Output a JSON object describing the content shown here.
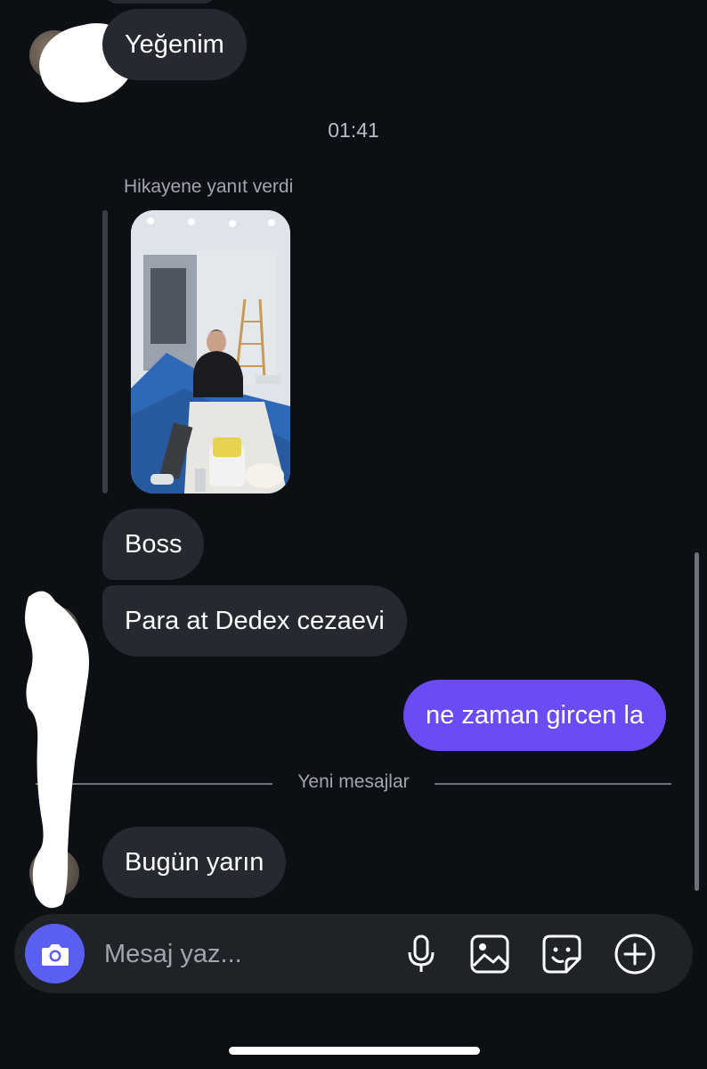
{
  "messages": {
    "m1": "Yeğenim",
    "time": "01:41",
    "reply_label": "Hikayene yanıt verdi",
    "m2": "Boss",
    "m3": "Para at Dedex cezaevi",
    "m4": "ne zaman gircen la",
    "new_messages": "Yeni mesajlar",
    "m5": "Bugün yarın"
  },
  "composer": {
    "placeholder": "Mesaj yaz..."
  },
  "colors": {
    "background": "#0c1014",
    "incoming_bubble": "#262a30",
    "outgoing_bubble": "#6c4bf5",
    "camera_button": "#5b5ff1"
  },
  "icons": [
    "camera-icon",
    "microphone-icon",
    "gallery-icon",
    "sticker-icon",
    "plus-icon"
  ]
}
